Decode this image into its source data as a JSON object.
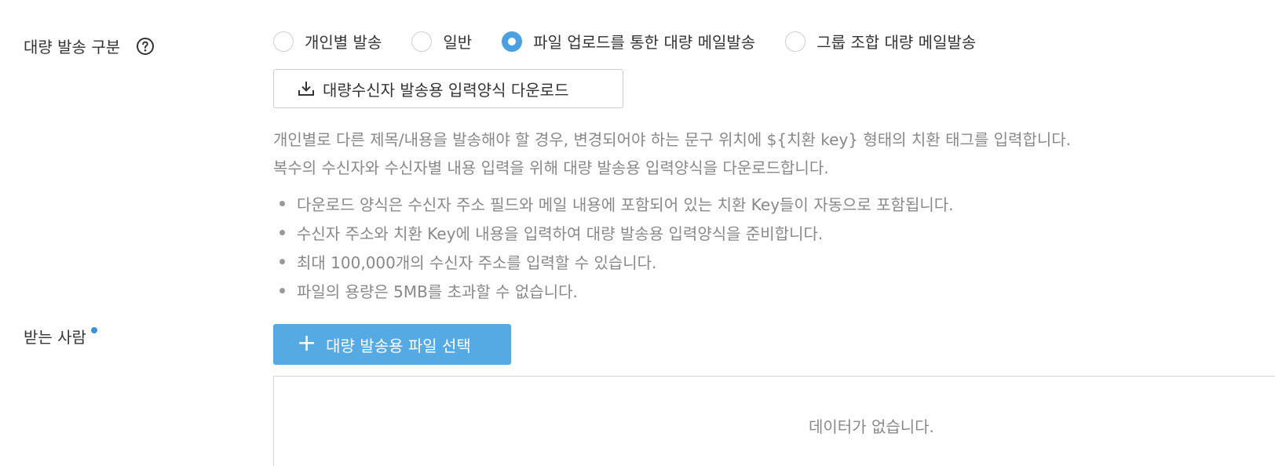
{
  "send_type": {
    "label": "대량 발송 구분",
    "help_icon": "question-circle-icon",
    "options": [
      {
        "label": "개인별 발송",
        "checked": false
      },
      {
        "label": "일반",
        "checked": false
      },
      {
        "label": "파일 업로드를 통한 대량 메일발송",
        "checked": true
      },
      {
        "label": "그룹 조합 대량 메일발송",
        "checked": false
      }
    ],
    "download_button": {
      "label": "대량수신자 발송용 입력양식 다운로드",
      "icon": "download-icon"
    },
    "description": [
      "개인별로 다른 제목/내용을 발송해야 할 경우, 변경되어야 하는 문구 위치에 ${치환 key} 형태의 치환 태그를 입력합니다.",
      "복수의 수신자와 수신자별 내용 입력을 위해 대량 발송용 입력양식을 다운로드합니다."
    ],
    "bullets": [
      "다운로드 양식은 수신자 주소 필드와 메일 내용에 포함되어 있는 치환 Key들이 자동으로 포함됩니다.",
      "수신자 주소와 치환 Key에 내용을 입력하여 대량 발송용 입력양식을 준비합니다.",
      "최대 100,000개의 수신자 주소를 입력할 수 있습니다.",
      "파일의 용량은 5MB를 초과할 수 없습니다."
    ]
  },
  "recipient": {
    "label": "받는 사람",
    "required_color": "#3d8fd8",
    "select_button": {
      "label": "대량 발송용 파일 선택",
      "icon": "plus-icon",
      "color": "#55aae4"
    },
    "empty_text": "데이터가 없습니다."
  },
  "colors": {
    "accent": "#4aa0e0"
  }
}
